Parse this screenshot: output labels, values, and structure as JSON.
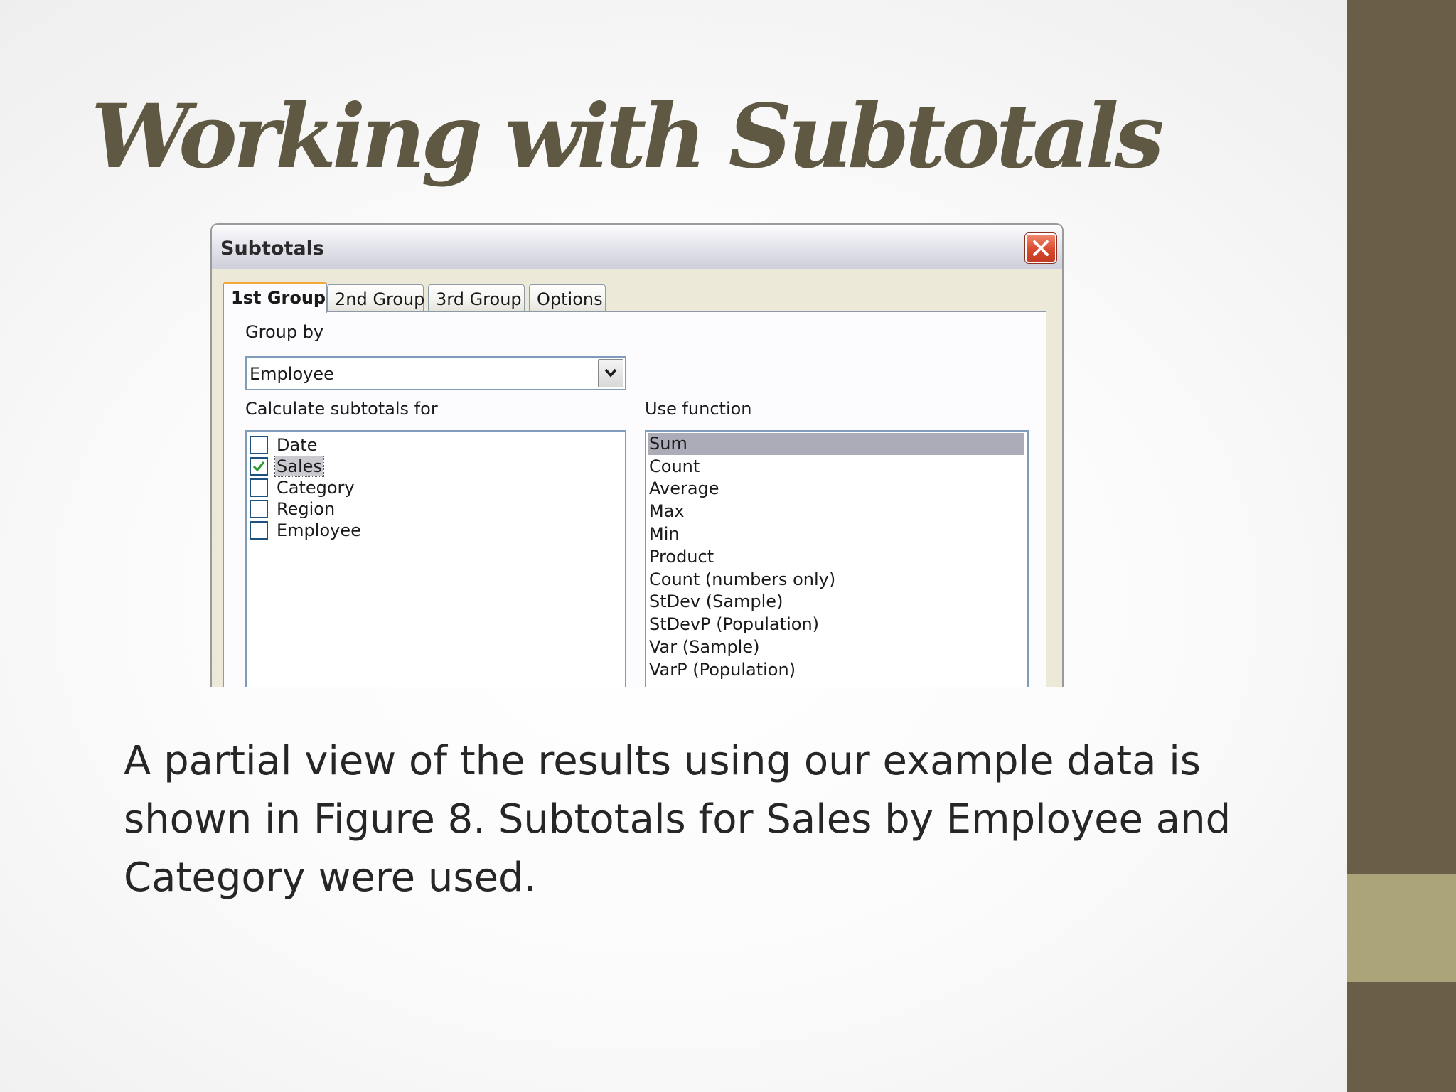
{
  "slide": {
    "title": "Working with Subtotals",
    "body": "A partial view of the results using our example data is shown in Figure 8. Subtotals for Sales by Employee and Category were used."
  },
  "dialog": {
    "title": "Subtotals",
    "tabs": [
      {
        "label": "1st Group",
        "active": true
      },
      {
        "label": "2nd Group",
        "active": false
      },
      {
        "label": "3rd Group",
        "active": false
      },
      {
        "label": "Options",
        "active": false
      }
    ],
    "group_by": {
      "label": "Group by",
      "value": "Employee"
    },
    "calculate": {
      "label": "Calculate subtotals for",
      "items": [
        {
          "label": "Date",
          "checked": false
        },
        {
          "label": "Sales",
          "checked": true,
          "selected": true
        },
        {
          "label": "Category",
          "checked": false
        },
        {
          "label": "Region",
          "checked": false
        },
        {
          "label": "Employee",
          "checked": false
        }
      ]
    },
    "use_function": {
      "label": "Use function",
      "selected": "Sum",
      "items": [
        "Sum",
        "Count",
        "Average",
        "Max",
        "Min",
        "Product",
        "Count (numbers only)",
        "StDev (Sample)",
        "StDevP (Population)",
        "Var (Sample)",
        "VarP (Population)"
      ]
    }
  },
  "colors": {
    "title": "#5f5843",
    "sidebar": "#6a5e48",
    "sidebar_accent": "#aba478",
    "check": "#2e9a2e"
  },
  "icons": {
    "close": "close-icon",
    "dropdown": "chevron-down-icon",
    "check": "checkmark-icon"
  }
}
